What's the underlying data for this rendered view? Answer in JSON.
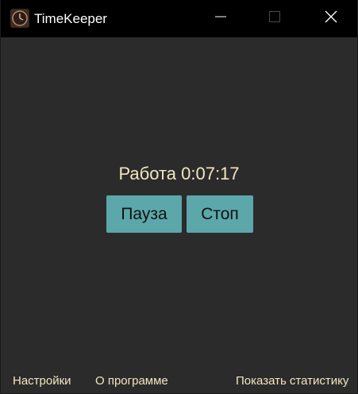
{
  "window": {
    "title": "TimeKeeper",
    "app_icon": "clock-icon"
  },
  "titlebar_buttons": {
    "minimize_icon": "minimize-icon",
    "maximize_icon": "maximize-icon",
    "close_icon": "close-icon"
  },
  "main": {
    "status_text": "Работа 0:07:17",
    "pause_label": "Пауза",
    "stop_label": "Стоп"
  },
  "footer": {
    "settings_label": "Настройки",
    "about_label": "О программе",
    "stats_label": "Показать статистику"
  },
  "colors": {
    "background": "#2b2b2b",
    "titlebar": "#000000",
    "text_accent": "#f3e6c0",
    "button": "#5ca7aa"
  }
}
